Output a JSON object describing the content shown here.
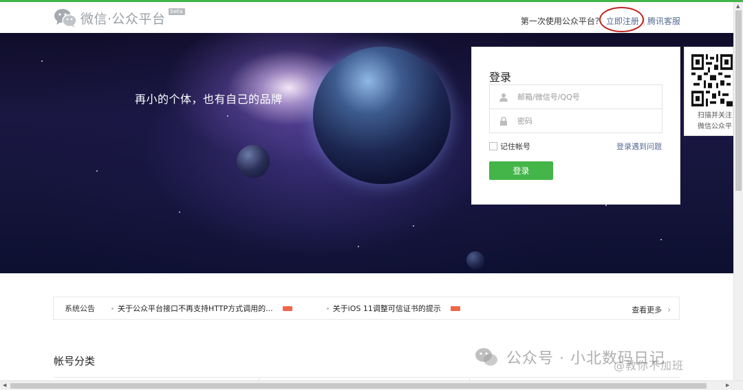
{
  "header": {
    "logo_text": "微信·公众平台",
    "logo_badge": "beta",
    "first_time_text": "第一次使用公众平台？",
    "register_link": "立即注册",
    "support_link": "腾讯客服"
  },
  "banner": {
    "slogan": "再小的个体，也有自己的品牌"
  },
  "login": {
    "title": "登录",
    "username_placeholder": "邮箱/微信号/QQ号",
    "password_placeholder": "密码",
    "remember_label": "记住帐号",
    "problem_link": "登录遇到问题",
    "submit_label": "登录"
  },
  "qr": {
    "line1": "扫描并关注",
    "line2": "微信公众平台"
  },
  "notice": {
    "title": "系统公告",
    "items": [
      {
        "text": "关于公众平台接口不再支持HTTP方式调用的..."
      },
      {
        "text": "关于iOS 11调整可信证书的提示"
      }
    ],
    "more": "查看更多"
  },
  "account_section": {
    "title": "帐号分类"
  },
  "watermark": {
    "main": "公众号 · 小北数码日记",
    "secondary": "@教你不加班"
  },
  "colors": {
    "brand_green": "#44b549",
    "link_blue": "#576b95",
    "annotation_red": "#c0211e"
  }
}
